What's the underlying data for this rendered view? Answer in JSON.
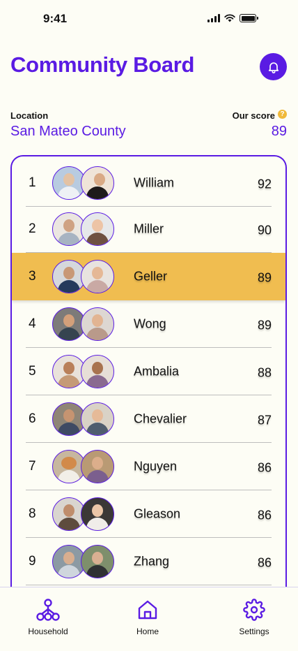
{
  "status": {
    "time": "9:41"
  },
  "header": {
    "title": "Community Board"
  },
  "location": {
    "label": "Location",
    "value": "San Mateo County"
  },
  "our_score": {
    "label": "Our score",
    "value": "89"
  },
  "leaderboard": [
    {
      "rank": "1",
      "name": "William",
      "score": "92"
    },
    {
      "rank": "2",
      "name": "Miller",
      "score": "90"
    },
    {
      "rank": "3",
      "name": "Geller",
      "score": "89"
    },
    {
      "rank": "4",
      "name": "Wong",
      "score": "89"
    },
    {
      "rank": "5",
      "name": "Ambalia",
      "score": "88"
    },
    {
      "rank": "6",
      "name": "Chevalier",
      "score": "87"
    },
    {
      "rank": "7",
      "name": "Nguyen",
      "score": "86"
    },
    {
      "rank": "8",
      "name": "Gleason",
      "score": "86"
    },
    {
      "rank": "9",
      "name": "Zhang",
      "score": "86"
    }
  ],
  "nav": {
    "household": "Household",
    "home": "Home",
    "settings": "Settings"
  },
  "colors": {
    "accent": "#5a1be3",
    "highlight": "#f0bd50"
  }
}
